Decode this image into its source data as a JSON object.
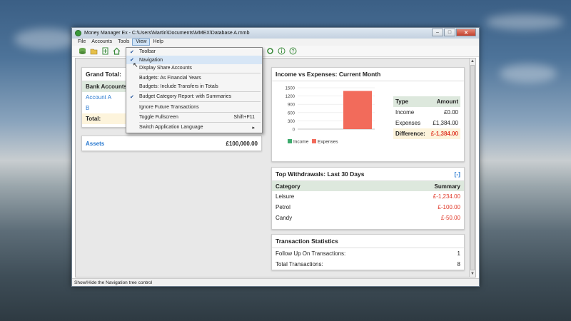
{
  "window": {
    "title": "Money Manager Ex - C:\\Users\\Martin\\Documents\\MMEX\\Database A.mmb",
    "controls": {
      "minimize": "–",
      "maximize": "□",
      "close": "✕"
    }
  },
  "menubar": {
    "items": [
      "File",
      "Accounts",
      "Tools",
      "View",
      "Help"
    ]
  },
  "view_menu": {
    "items": [
      {
        "label": "Toolbar",
        "checked": true
      },
      {
        "label": "Navigation",
        "checked": true
      },
      {
        "label": "Display Share Accounts",
        "checked": false
      },
      {
        "label": "Budgets: As Financial Years",
        "checked": false
      },
      {
        "label": "Budgets: Include Transfers in Totals",
        "checked": false
      },
      {
        "label": "Budget Category Report: with Summaries",
        "checked": true
      },
      {
        "label": "Ignore Future Transactions",
        "checked": false
      },
      {
        "label": "Toggle Fullscreen",
        "shortcut": "Shift+F11",
        "checked": false
      },
      {
        "label": "Switch Application Language",
        "submenu": "▸",
        "checked": false
      }
    ]
  },
  "grand_total": {
    "title": "Grand Total:",
    "bank_header": "Bank Accounts",
    "accounts": [
      "Account A",
      "B"
    ],
    "total_label": "Total:"
  },
  "assets": {
    "label": "Assets",
    "value": "£100,000.00"
  },
  "income_expenses": {
    "title": "Income vs Expenses: Current Month",
    "table": {
      "headers": [
        "Type",
        "Amount"
      ],
      "rows": [
        [
          "Income",
          "£0.00"
        ],
        [
          "Expenses",
          "£1,384.00"
        ]
      ],
      "difference_label": "Difference:",
      "difference_value": "£-1,384.00"
    },
    "legend": [
      "Income",
      "Expenses"
    ]
  },
  "chart_data": {
    "type": "bar",
    "categories": [
      "Income",
      "Expenses"
    ],
    "values": [
      0,
      1384
    ],
    "ylim": [
      0,
      1500
    ],
    "yticks": [
      "1500",
      "1200",
      "900",
      "600",
      "300",
      "0"
    ],
    "colors": [
      "#3caa6c",
      "#f26b5b"
    ]
  },
  "withdrawals": {
    "title": "Top Withdrawals: Last 30 Days",
    "collapse": "[-]",
    "headers": [
      "Category",
      "Summary"
    ],
    "rows": [
      [
        "Leisure",
        "£-1,234.00"
      ],
      [
        "Petrol",
        "£-100.00"
      ],
      [
        "Candy",
        "£-50.00"
      ]
    ]
  },
  "stats": {
    "title": "Transaction Statistics",
    "rows": [
      [
        "Follow Up On Transactions:",
        "1"
      ],
      [
        "Total Transactions:",
        "8"
      ]
    ]
  },
  "statusbar": {
    "text": "Show/Hide the Navigation tree control"
  }
}
